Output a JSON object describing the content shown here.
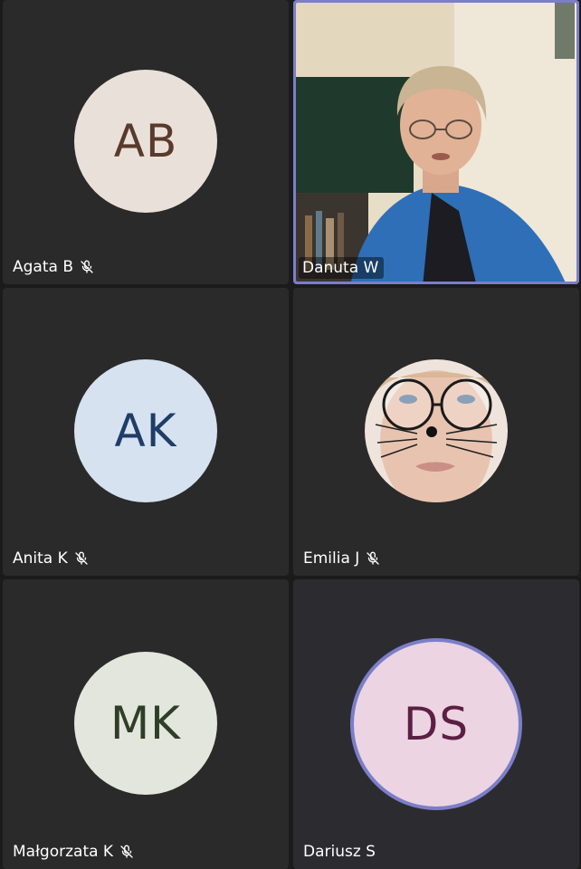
{
  "participants": [
    {
      "name": "Agata B",
      "initials": "AB",
      "muted": true,
      "avatar_bg": "#eae0da",
      "avatar_fg": "#5a3a2c",
      "mic_icon": "mic-off-icon"
    },
    {
      "name": "Danuta W",
      "video": true,
      "active_speaker": true,
      "muted": false
    },
    {
      "name": "Anita K",
      "initials": "AK",
      "muted": true,
      "avatar_bg": "#d6e2f0",
      "avatar_fg": "#1f3d66",
      "mic_icon": "mic-off-icon"
    },
    {
      "name": "Emilia J",
      "video_avatar": true,
      "muted": true,
      "mic_icon": "mic-off-icon"
    },
    {
      "name": "Małgorzata K",
      "initials": "MK",
      "muted": true,
      "avatar_bg": "#e2e6dc",
      "avatar_fg": "#2f3e26",
      "mic_icon": "mic-off-icon"
    },
    {
      "name": "Dariusz S",
      "initials": "DS",
      "muted": false,
      "active_speaker": true,
      "avatar_bg": "#ecd4e2",
      "avatar_fg": "#5c1f44"
    }
  ],
  "colors": {
    "background": "#1b1b1b",
    "tile": "#2a2a2a",
    "active_ring": "#7b7ec8"
  }
}
